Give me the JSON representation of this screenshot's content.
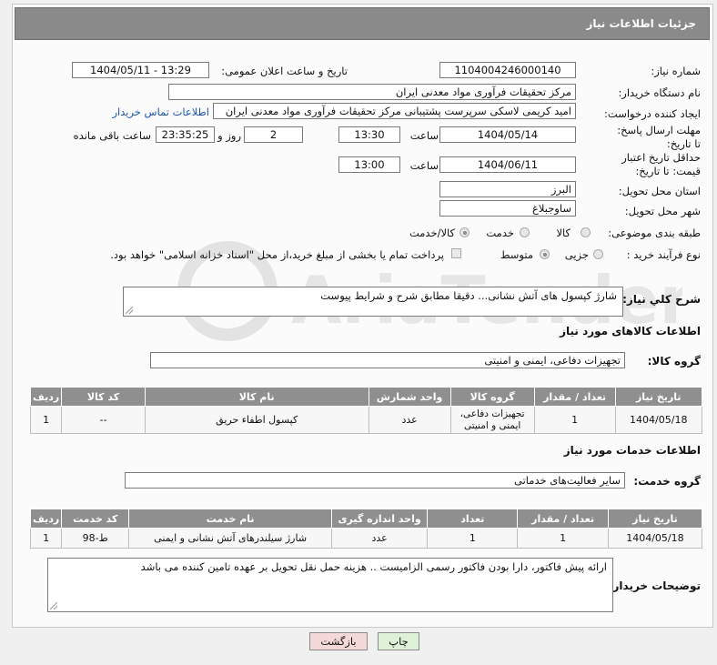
{
  "title": "جزئیات اطلاعات نیاز",
  "labels": {
    "need_number": "شماره نیاز:",
    "announce_datetime": "تاریخ و ساعت اعلان عمومی:",
    "buyer_org": "نام دستگاه خریدار:",
    "requester": "ایجاد کننده درخواست:",
    "reply_deadline": "مهلت ارسال پاسخ: تا تاریخ:",
    "time": "ساعت",
    "days_and": "روز و",
    "remaining": "ساعت باقی مانده",
    "price_validity": "حداقل تاریخ اعتبار قیمت: تا تاریخ:",
    "time2": "ساعت",
    "province": "استان محل تحویل:",
    "city": "شهر محل تحویل:",
    "category": "طبقه بندی موضوعی:",
    "process_type": "نوع فرآیند خرید :",
    "general_desc": "شرح کلي نیاز:",
    "goods_info": "اطلاعات کالاهای مورد نیاز",
    "goods_group": "گروه کالا:",
    "services_info": "اطلاعات خدمات مورد نیاز",
    "service_group": "گروه خدمت:",
    "buyer_notes": "توضیحات خریدار:"
  },
  "values": {
    "need_number": "1104004246000140",
    "announce_datetime": "1404/05/11 - 13:29",
    "buyer_org": "مرکز تحقیقات فرآوری مواد معدنی ایران",
    "requester": "امید کریمی لاسکی سرپرست پشتیبانی مرکز تحقیقات فرآوری مواد معدنی ایران",
    "contact_link": "اطلاعات تماس خریدار",
    "reply_date": "1404/05/14",
    "reply_time": "13:30",
    "days": "2",
    "remaining_time": "23:35:25",
    "validity_date": "1404/06/11",
    "validity_time": "13:00",
    "province": "البرز",
    "city": "ساوجبلاغ",
    "general_desc": "شارژ کپسول های آتش نشانی... دقیقا مطابق شرح و شرایط پیوست",
    "goods_group": "تجهیزات دفاعی، ایمنی و امنیتی",
    "service_group": "سایر فعالیت‌های خدماتی",
    "buyer_notes": "ارائه پیش فاکتور، دارا بودن فاکتور رسمی الزامیست .. هزینه حمل نقل تحویل بر عهده تامین کننده می باشد"
  },
  "category_options": [
    "کالا",
    "خدمت",
    "کالا/خدمت"
  ],
  "category_selected": "کالا/خدمت",
  "process_options": [
    "جزیی",
    "متوسط"
  ],
  "process_selected": "متوسط",
  "payment_note": "پرداخت تمام یا بخشی از مبلغ خرید،از محل \"اسناد خزانه اسلامی\" خواهد بود.",
  "goods_table": {
    "headers": [
      "ردیف",
      "کد کالا",
      "نام کالا",
      "واحد شمارش",
      "گروه کالا",
      "تعداد / مقدار",
      "تاریخ نیاز"
    ],
    "rows": [
      [
        "1",
        "--",
        "کپسول اطفاء حریق",
        "عدد",
        "تجهیزات دفاعی، ایمنی و امنیتی",
        "1",
        "1404/05/18"
      ]
    ]
  },
  "services_table": {
    "headers": [
      "ردیف",
      "کد خدمت",
      "نام خدمت",
      "واحد اندازه گیری",
      "تعداد",
      "تعداد / مقدار",
      "تاریخ نیاز"
    ],
    "rows": [
      [
        "1",
        "ط-98",
        "شارژ سیلندرهای آتش نشانی و ایمنی",
        "عدد",
        "1",
        "1",
        "1404/05/18"
      ]
    ]
  },
  "buttons": {
    "print": "چاپ",
    "back": "بازگشت"
  },
  "watermark": "AriaTender.net",
  "colors": {
    "header_bg": "#8a8a8a",
    "link": "#1a55b5",
    "back_btn": "#f4d9d9",
    "print_btn": "#dff0d8"
  }
}
